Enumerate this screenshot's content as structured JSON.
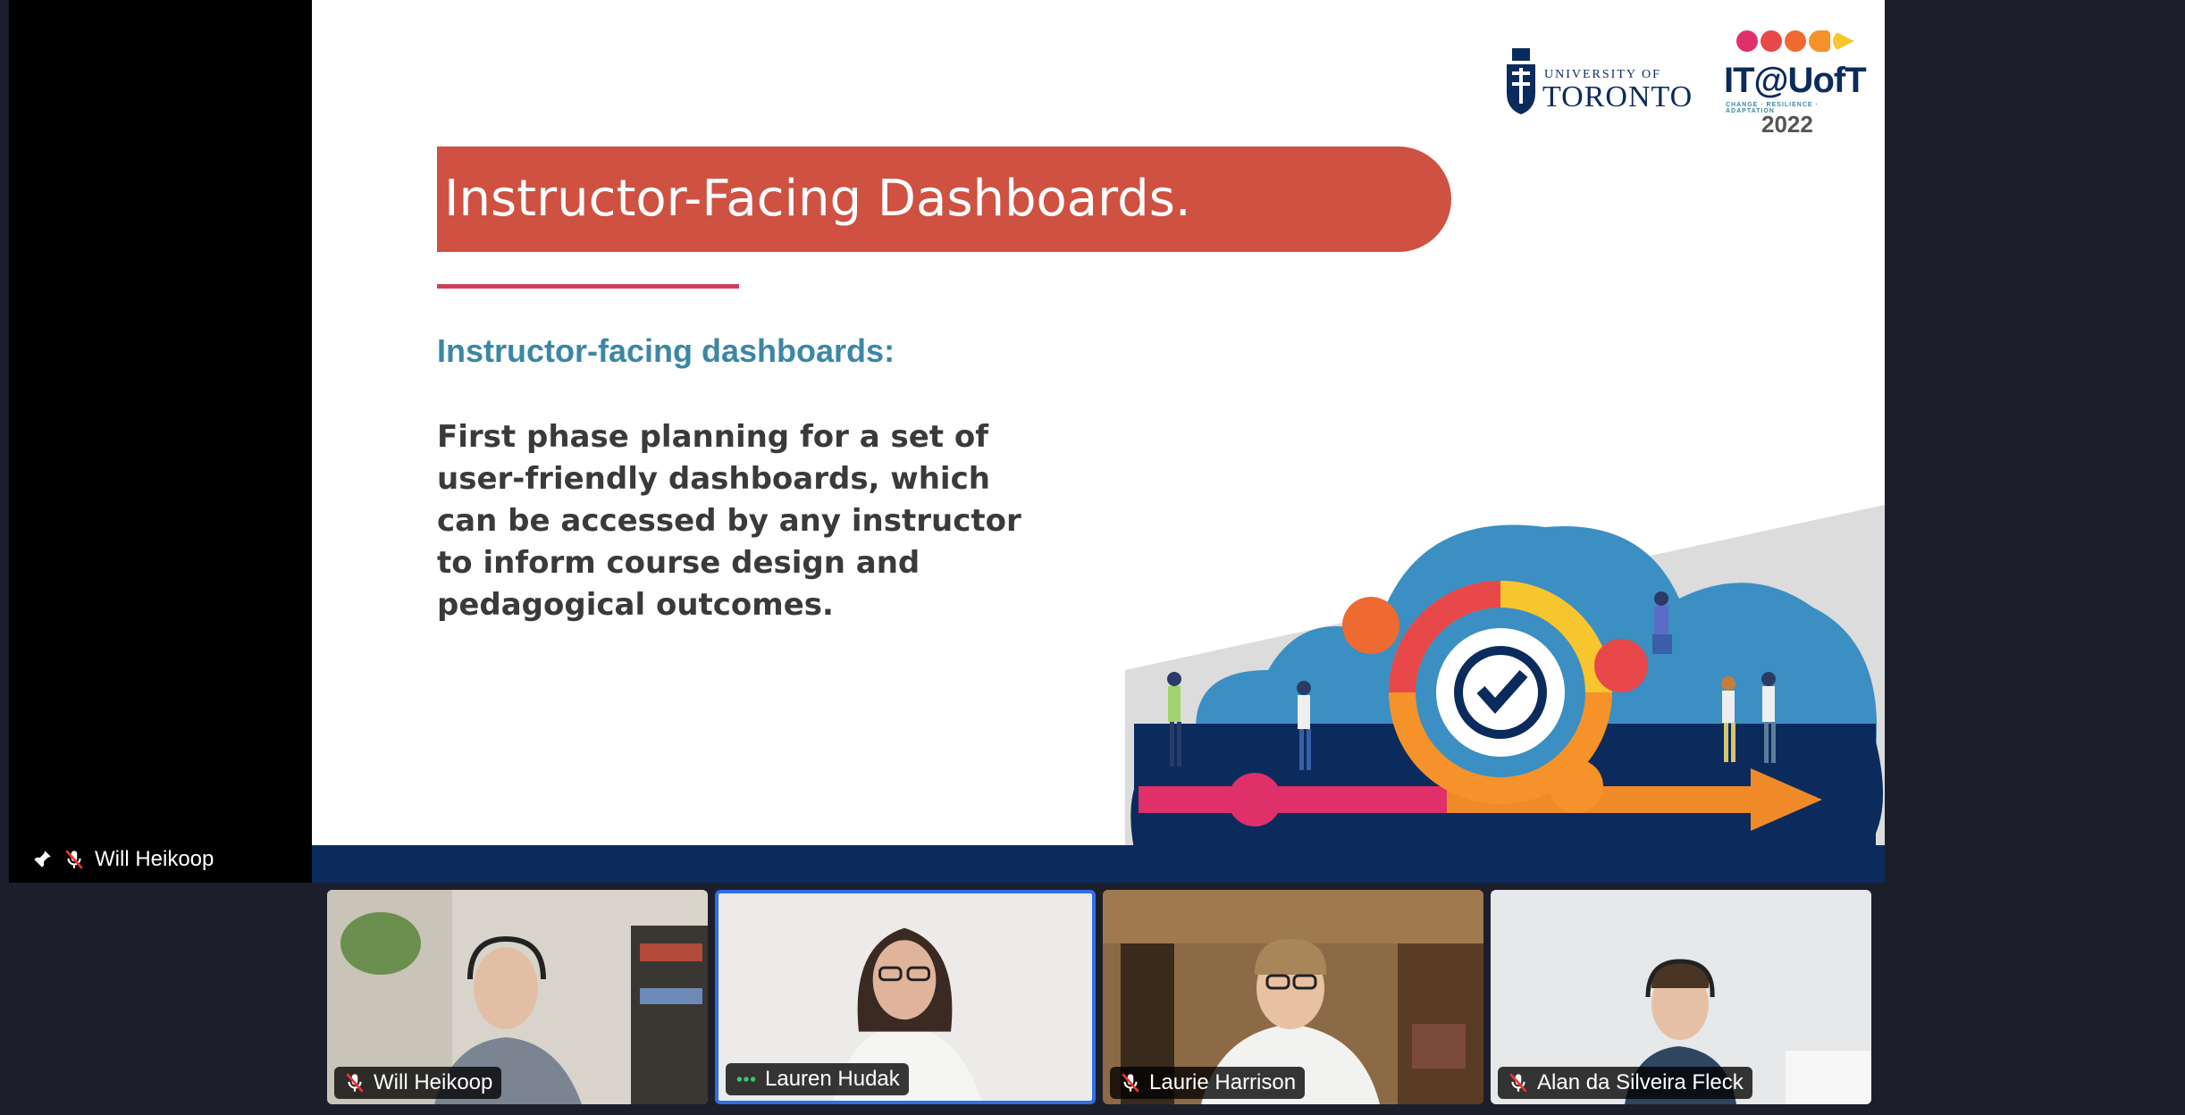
{
  "slide": {
    "title": "Instructor-Facing Dashboards.",
    "subheading": "Instructor-facing dashboards:",
    "body": "First phase planning for a set of user-friendly dashboards, which can be accessed by any instructor to inform course design and pedagogical outcomes.",
    "logo_uoft_small": "UNIVERSITY OF",
    "logo_uoft_big": "TORONTO",
    "logo_itoft": "IT@UofT",
    "logo_itoft_tagline": "CHANGE · RESILIENCE · ADAPTATION",
    "logo_itoft_year": "2022"
  },
  "main_speaker": {
    "name": "Will Heikoop",
    "pinned": true,
    "muted": true,
    "icons": [
      "pin-icon",
      "mic-muted-icon"
    ]
  },
  "participants": [
    {
      "name": "Will Heikoop",
      "status_icon": "mic-muted-icon",
      "active": false
    },
    {
      "name": "Lauren Hudak",
      "status_icon": "speaking-dots-icon",
      "active": true
    },
    {
      "name": "Laurie Harrison",
      "status_icon": "mic-muted-icon",
      "active": false
    },
    {
      "name": "Alan da Silveira Fleck",
      "status_icon": "mic-muted-icon",
      "active": false
    }
  ],
  "colors": {
    "banner": "#cf5141",
    "accent_rule": "#cf3f5c",
    "subheading": "#3b87a5",
    "navy": "#0b2b5c",
    "active_tile_border": "#2f6fe8",
    "speaking_green": "#37c871"
  }
}
